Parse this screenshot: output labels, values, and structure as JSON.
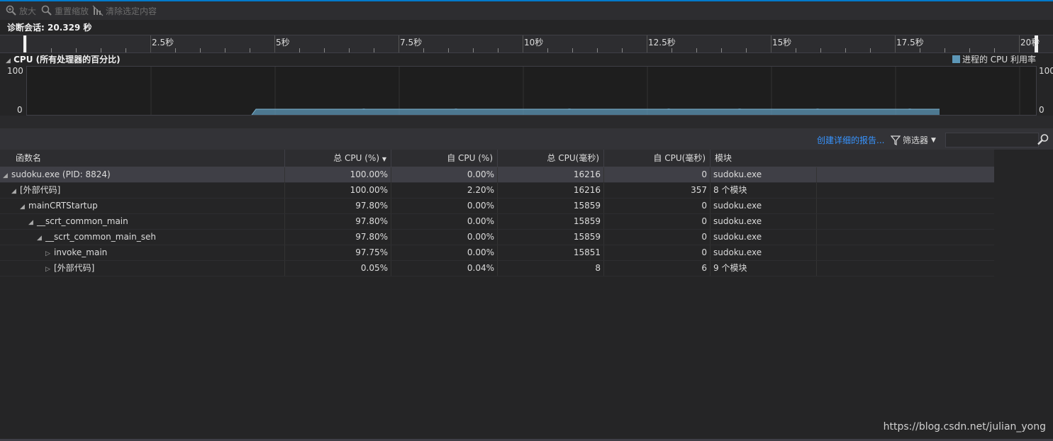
{
  "toolbar": {
    "zoom_label": "放大",
    "reset_zoom_label": "重置缩放",
    "clear_selection_label": "清除选定内容"
  },
  "session": {
    "label": "诊断会话: 20.329 秒"
  },
  "ruler": {
    "labels": [
      "2.5秒",
      "5秒",
      "7.5秒",
      "10秒",
      "12.5秒",
      "15秒",
      "17.5秒",
      "20秒"
    ]
  },
  "cpu_graph": {
    "title": "CPU (所有处理器的百分比)",
    "legend": "进程的 CPU 利用率",
    "y_max": "100",
    "y_min": "0",
    "series_color": "#5d97b7"
  },
  "actions": {
    "report_link": "创建详细的报告...",
    "filter_label": "筛选器"
  },
  "table": {
    "headers": [
      "函数名",
      "总 CPU (%)",
      "自 CPU (%)",
      "总 CPU(毫秒)",
      "自 CPU(毫秒)",
      "模块"
    ],
    "rows": [
      {
        "name": "sudoku.exe (PID: 8824)",
        "total_pct": "100.00%",
        "self_pct": "0.00%",
        "total_ms": "16216",
        "self_ms": "0",
        "module": "sudoku.exe"
      },
      {
        "name": "[外部代码]",
        "total_pct": "100.00%",
        "self_pct": "2.20%",
        "total_ms": "16216",
        "self_ms": "357",
        "module": "8 个模块"
      },
      {
        "name": "mainCRTStartup",
        "total_pct": "97.80%",
        "self_pct": "0.00%",
        "total_ms": "15859",
        "self_ms": "0",
        "module": "sudoku.exe"
      },
      {
        "name": "__scrt_common_main",
        "total_pct": "97.80%",
        "self_pct": "0.00%",
        "total_ms": "15859",
        "self_ms": "0",
        "module": "sudoku.exe"
      },
      {
        "name": "__scrt_common_main_seh",
        "total_pct": "97.80%",
        "self_pct": "0.00%",
        "total_ms": "15859",
        "self_ms": "0",
        "module": "sudoku.exe"
      },
      {
        "name": "invoke_main",
        "total_pct": "97.75%",
        "self_pct": "0.00%",
        "total_ms": "15851",
        "self_ms": "0",
        "module": "sudoku.exe"
      },
      {
        "name": "[外部代码]",
        "total_pct": "0.05%",
        "self_pct": "0.04%",
        "total_ms": "8",
        "self_ms": "6",
        "module": "9 个模块"
      }
    ]
  },
  "watermark": "https://blog.csdn.net/julian_yong"
}
